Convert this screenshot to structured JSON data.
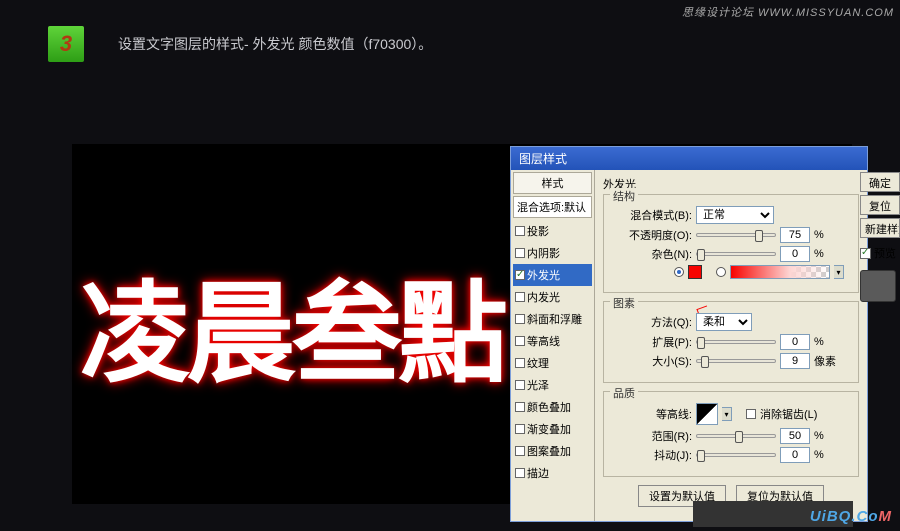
{
  "watermark_top": "思缘设计论坛 WWW.MISSYUAN.COM",
  "step_number": "3",
  "step_instruction": "设置文字图层的样式- 外发光 颜色数值（f70300）。",
  "preview_text": "凌晨叁點",
  "dialog": {
    "title": "图层样式",
    "styles_header": "样式",
    "blend_header": "混合选项:默认",
    "items": [
      {
        "label": "投影",
        "checked": false
      },
      {
        "label": "内阴影",
        "checked": false
      },
      {
        "label": "外发光",
        "checked": true,
        "selected": true
      },
      {
        "label": "内发光",
        "checked": false
      },
      {
        "label": "斜面和浮雕",
        "checked": false
      },
      {
        "label": "等高线",
        "checked": false
      },
      {
        "label": "纹理",
        "checked": false
      },
      {
        "label": "光泽",
        "checked": false
      },
      {
        "label": "颜色叠加",
        "checked": false
      },
      {
        "label": "渐变叠加",
        "checked": false
      },
      {
        "label": "图案叠加",
        "checked": false
      },
      {
        "label": "描边",
        "checked": false
      }
    ],
    "section_title": "外发光",
    "groups": {
      "structure": "结构",
      "elements": "图素",
      "quality": "品质"
    },
    "labels": {
      "blend_mode": "混合模式(B):",
      "opacity": "不透明度(O):",
      "noise": "杂色(N):",
      "method": "方法(Q):",
      "spread": "扩展(P):",
      "size": "大小(S):",
      "contour": "等高线:",
      "antialias": "消除锯齿(L)",
      "range": "范围(R):",
      "jitter": "抖动(J):"
    },
    "values": {
      "blend_mode": "正常",
      "opacity": "75",
      "noise": "0",
      "color": "#f70300",
      "method": "柔和",
      "spread": "0",
      "size": "9",
      "range": "50",
      "jitter": "0"
    },
    "units": {
      "percent": "%",
      "px": "像素"
    },
    "annotation": "f70300",
    "buttons": {
      "ok": "确定",
      "cancel": "复位",
      "new_style": "新建样式",
      "preview": "预览",
      "set_default": "设置为默认值",
      "reset_default": "复位为默认值"
    }
  },
  "watermark_bottom": "UiBQ.CoM"
}
